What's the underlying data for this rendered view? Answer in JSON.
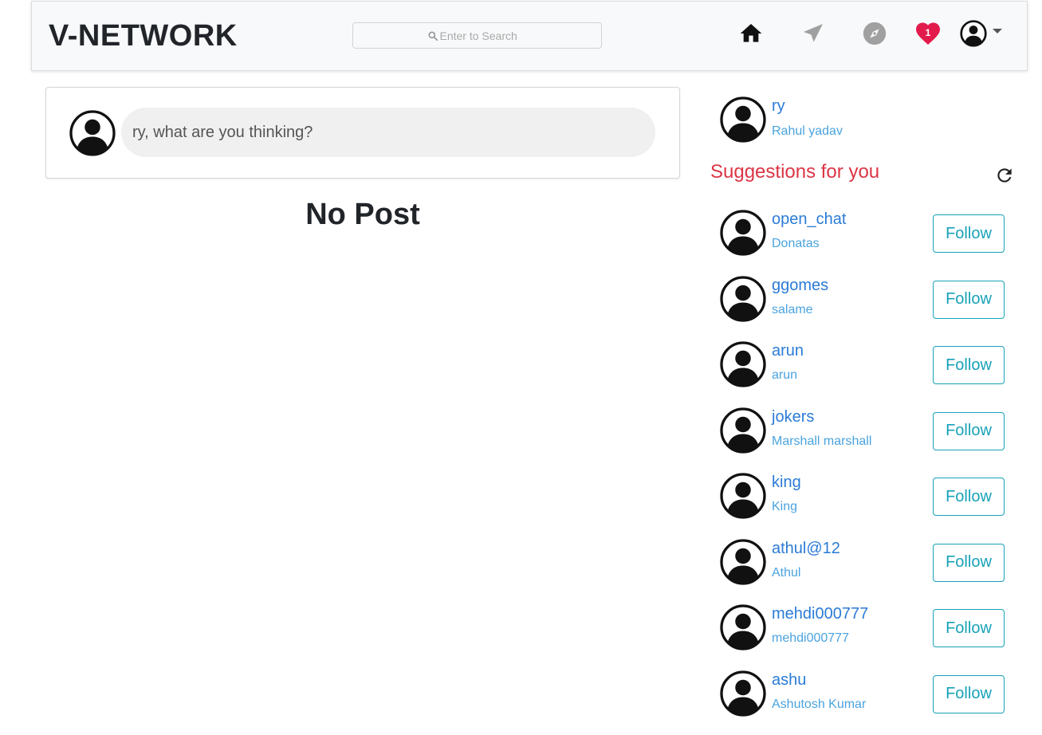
{
  "app": {
    "brand": "V-NETWORK"
  },
  "search": {
    "placeholder": "Enter to Search"
  },
  "nav": {
    "icons": [
      "home-icon",
      "send-icon",
      "compass-icon",
      "heart-icon",
      "profile-icon"
    ],
    "notification_count": "1",
    "colors": {
      "home": "#111111",
      "inactive": "#a0a0a0",
      "heart": "#e31b4d"
    }
  },
  "composer": {
    "prompt": "ry, what are you thinking?"
  },
  "feed": {
    "empty_text": "No Post"
  },
  "current_user": {
    "username": "ry",
    "fullname": "Rahul yadav"
  },
  "suggestions": {
    "title": "Suggestions for you",
    "follow_label": "Follow",
    "items": [
      {
        "username": "open_chat",
        "fullname": "Donatas"
      },
      {
        "username": "ggomes",
        "fullname": "salame"
      },
      {
        "username": "arun",
        "fullname": "arun"
      },
      {
        "username": "jokers",
        "fullname": "Marshall marshall"
      },
      {
        "username": "king",
        "fullname": "King"
      },
      {
        "username": "athul@12",
        "fullname": "Athul"
      },
      {
        "username": "mehdi000777",
        "fullname": "mehdi000777"
      },
      {
        "username": "ashu",
        "fullname": "Ashutosh Kumar"
      }
    ]
  },
  "colors": {
    "accent": "#dc3545",
    "link": "#2b7bd6",
    "follow": "#17a2b8"
  }
}
